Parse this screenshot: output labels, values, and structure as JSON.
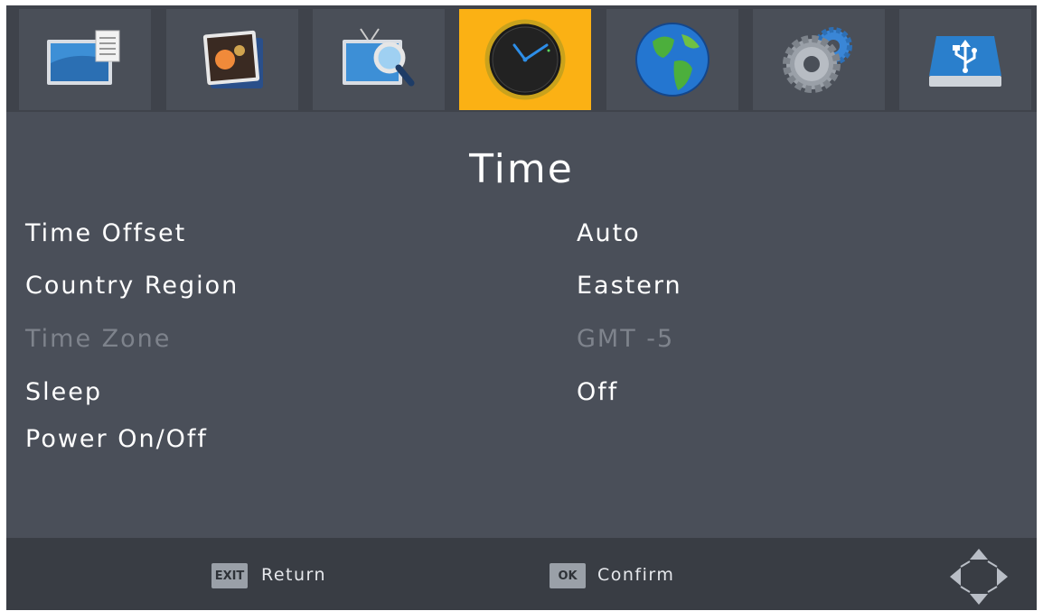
{
  "tabs": [
    {
      "name": "picture-menu",
      "icon": "picture-monitor-icon"
    },
    {
      "name": "media-menu",
      "icon": "photo-album-icon"
    },
    {
      "name": "channel-search-menu",
      "icon": "tv-search-icon"
    },
    {
      "name": "time-menu",
      "icon": "clock-icon",
      "selected": true
    },
    {
      "name": "language-menu",
      "icon": "globe-icon"
    },
    {
      "name": "system-settings-menu",
      "icon": "gears-icon"
    },
    {
      "name": "usb-menu",
      "icon": "usb-drive-icon"
    }
  ],
  "colors": {
    "accent": "#fbb114",
    "background": "#4a4f59",
    "disabled_text": "#7e838c"
  },
  "page": {
    "title": "Time"
  },
  "rows": [
    {
      "label": "Time Offset",
      "value": "Auto",
      "disabled": false
    },
    {
      "label": "Country Region",
      "value": "Eastern",
      "disabled": false
    },
    {
      "label": "Time Zone",
      "value": "GMT -5",
      "disabled": true
    },
    {
      "label": "Sleep",
      "value": "Off",
      "disabled": false
    },
    {
      "label": "Power On/Off",
      "value": "",
      "disabled": false
    }
  ],
  "footer": {
    "exit_key": "EXIT",
    "return_label": "Return",
    "ok_key": "OK",
    "confirm_label": "Confirm",
    "nav_icon": "dpad-arrows-icon"
  }
}
